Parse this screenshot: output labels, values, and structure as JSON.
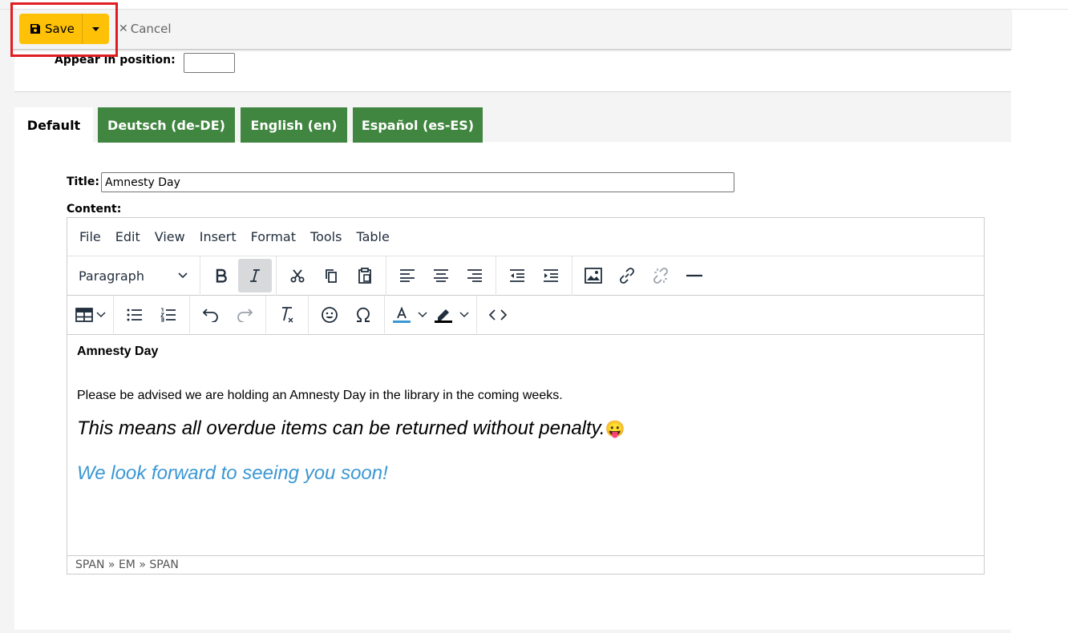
{
  "toolbar": {
    "save_label": "Save",
    "cancel_label": "Cancel"
  },
  "position": {
    "label": "Appear in position:",
    "value": ""
  },
  "tabs": [
    {
      "label": "Default",
      "active": true
    },
    {
      "label": "Deutsch (de-DE)",
      "active": false
    },
    {
      "label": "English (en)",
      "active": false
    },
    {
      "label": "Español (es-ES)",
      "active": false
    }
  ],
  "form": {
    "title_label": "Title:",
    "title_value": "Amnesty Day",
    "content_label": "Content:"
  },
  "editor": {
    "menus": [
      "File",
      "Edit",
      "View",
      "Insert",
      "Format",
      "Tools",
      "Table"
    ],
    "block_format": "Paragraph",
    "toolbar_row1_icons": [
      "bold-icon",
      "italic-icon",
      "cut-icon",
      "copy-icon",
      "paste-icon",
      "align-left-icon",
      "align-center-icon",
      "align-right-icon",
      "outdent-icon",
      "indent-icon",
      "image-icon",
      "link-icon",
      "unlink-icon",
      "horizontal-rule-icon"
    ],
    "toolbar_row2_icons": [
      "table-icon",
      "bullet-list-icon",
      "numbered-list-icon",
      "undo-icon",
      "redo-icon",
      "clear-formatting-icon",
      "emoji-icon",
      "special-character-icon",
      "text-color-icon",
      "highlight-color-icon",
      "source-code-icon"
    ],
    "content": {
      "heading": "Amnesty Day",
      "body": "Please be advised we are holding an Amnesty Day in the library in the coming weeks.",
      "emphasis": "This means all overdue items can be returned without penalty.",
      "emoji": "😛",
      "closing": "We look forward to seeing you soon!"
    },
    "statusbar_path": "SPAN » EM » SPAN"
  },
  "colors": {
    "save_button": "#ffc107",
    "tab_green": "#408540",
    "closing_text": "#3b97d3",
    "highlight_box": "#e11d21"
  }
}
